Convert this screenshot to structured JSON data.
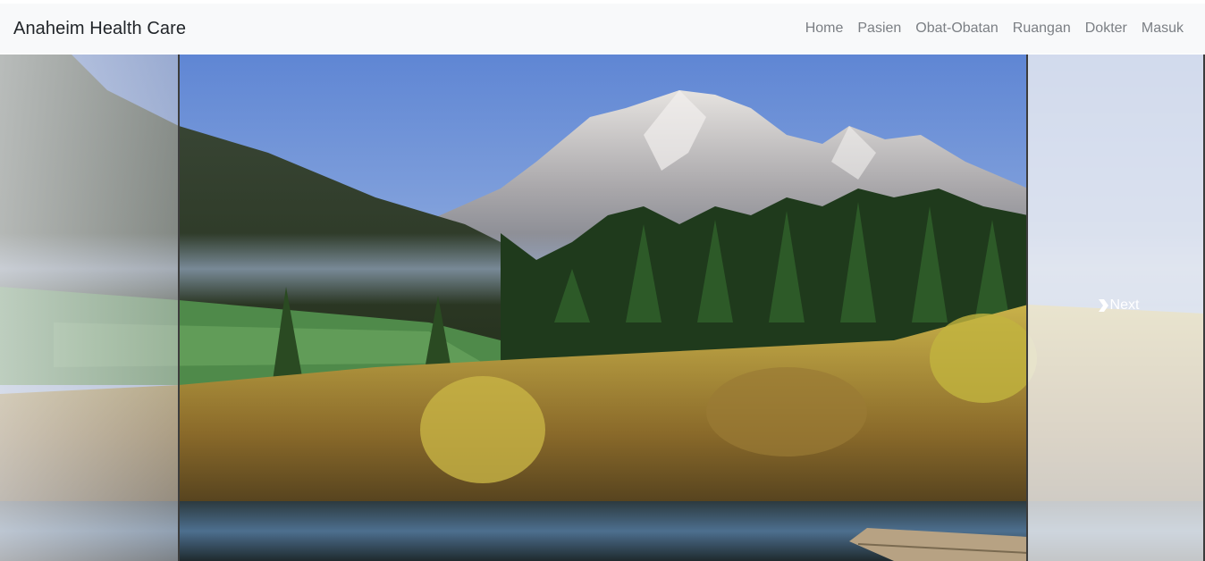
{
  "navbar": {
    "brand": "Anaheim Health Care",
    "links": [
      {
        "label": "Home"
      },
      {
        "label": "Pasien"
      },
      {
        "label": "Obat-Obatan"
      },
      {
        "label": "Ruangan"
      },
      {
        "label": "Dokter"
      },
      {
        "label": "Masuk"
      }
    ]
  },
  "carousel": {
    "next_label": "Next",
    "next_icon": "chevron-right-icon"
  },
  "colors": {
    "navbar_bg": "#f8f9fa",
    "brand_text": "#212529",
    "nav_link": "#7b7f84"
  }
}
